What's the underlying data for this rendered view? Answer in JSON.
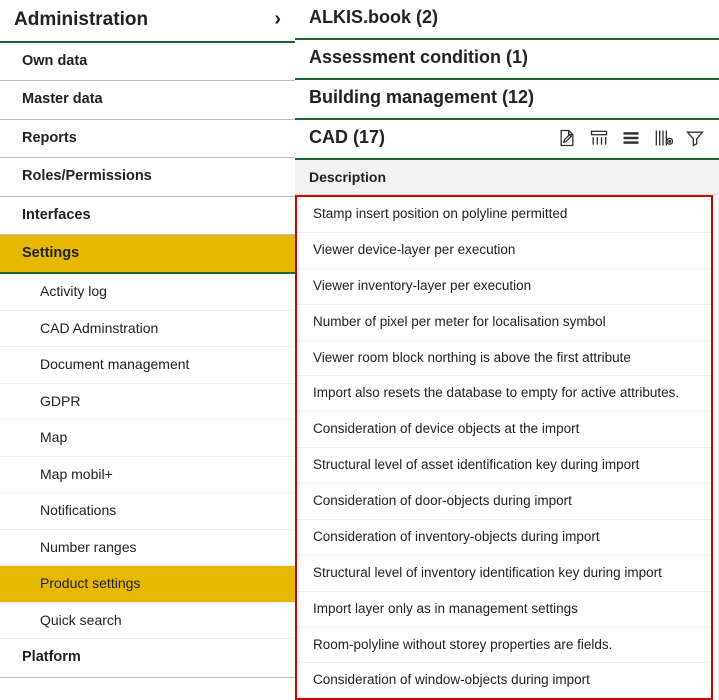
{
  "sidebar": {
    "title": "Administration",
    "items": [
      {
        "label": "Own data"
      },
      {
        "label": "Master data"
      },
      {
        "label": "Reports"
      },
      {
        "label": "Roles/Permissions"
      },
      {
        "label": "Interfaces"
      },
      {
        "label": "Settings",
        "active": true
      },
      {
        "label": "Platform"
      }
    ],
    "settings_children": [
      {
        "label": "Activity log"
      },
      {
        "label": "CAD Adminstration"
      },
      {
        "label": "Document management"
      },
      {
        "label": "GDPR"
      },
      {
        "label": "Map"
      },
      {
        "label": "Map mobil+"
      },
      {
        "label": "Notifications"
      },
      {
        "label": "Number ranges"
      },
      {
        "label": "Product settings",
        "active": true
      },
      {
        "label": "Quick search"
      }
    ]
  },
  "sections": [
    {
      "title": "ALKIS.book (2)"
    },
    {
      "title": "Assessment condition (1)"
    },
    {
      "title": "Building management (12)"
    },
    {
      "title": "CAD (17)",
      "toolbar": true
    }
  ],
  "description_header": "Description",
  "description_rows": [
    "Stamp insert position on polyline permitted",
    "Viewer device-layer per execution",
    "Viewer inventory-layer per execution",
    "Number of pixel per meter for localisation symbol",
    "Viewer room block northing is above the first attribute",
    "Import also resets the database to empty for active attributes.",
    "Consideration of device objects at the import",
    "Structural level of asset identification key during import",
    "Consideration of door-objects during import",
    "Consideration of inventory-objects during import",
    "Structural level of inventory identification key during import",
    "Import layer only as in management settings",
    "Room-polyline without storey properties are fields.",
    "Consideration of window-objects during import"
  ]
}
